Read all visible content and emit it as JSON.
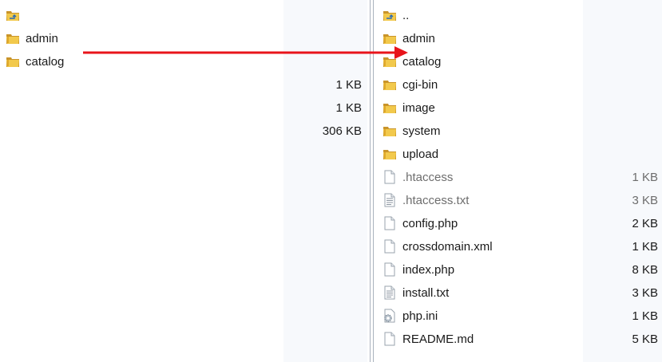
{
  "left_pane": {
    "items": [
      {
        "name": "",
        "icon": "folder-up-icon",
        "size": ""
      },
      {
        "name": "admin",
        "icon": "folder-icon",
        "size": ""
      },
      {
        "name": "catalog",
        "icon": "folder-icon",
        "size": ""
      },
      {
        "name": "",
        "icon": "",
        "size": "1 KB"
      },
      {
        "name": "",
        "icon": "",
        "size": "1 KB"
      },
      {
        "name": "",
        "icon": "",
        "size": "306 KB"
      }
    ]
  },
  "right_pane": {
    "items": [
      {
        "name": "..",
        "icon": "folder-up-icon",
        "size": ""
      },
      {
        "name": "admin",
        "icon": "folder-icon",
        "size": ""
      },
      {
        "name": "catalog",
        "icon": "folder-icon",
        "size": ""
      },
      {
        "name": "cgi-bin",
        "icon": "folder-icon",
        "size": ""
      },
      {
        "name": "image",
        "icon": "folder-icon",
        "size": ""
      },
      {
        "name": "system",
        "icon": "folder-icon",
        "size": ""
      },
      {
        "name": "upload",
        "icon": "folder-icon",
        "size": ""
      },
      {
        "name": ".htaccess",
        "icon": "file-icon",
        "size": "1 KB",
        "hidden": true
      },
      {
        "name": ".htaccess.txt",
        "icon": "text-file-icon",
        "size": "3 KB",
        "hidden": true
      },
      {
        "name": "config.php",
        "icon": "file-icon",
        "size": "2 KB"
      },
      {
        "name": "crossdomain.xml",
        "icon": "file-icon",
        "size": "1 KB"
      },
      {
        "name": "index.php",
        "icon": "file-icon",
        "size": "8 KB"
      },
      {
        "name": "install.txt",
        "icon": "text-file-icon",
        "size": "3 KB"
      },
      {
        "name": "php.ini",
        "icon": "settings-file-icon",
        "size": "1 KB"
      },
      {
        "name": "README.md",
        "icon": "file-icon",
        "size": "5 KB"
      }
    ]
  },
  "colors": {
    "arrow": "#e8141b",
    "folder": "#e8b93a",
    "folder_dark": "#c9942a"
  }
}
